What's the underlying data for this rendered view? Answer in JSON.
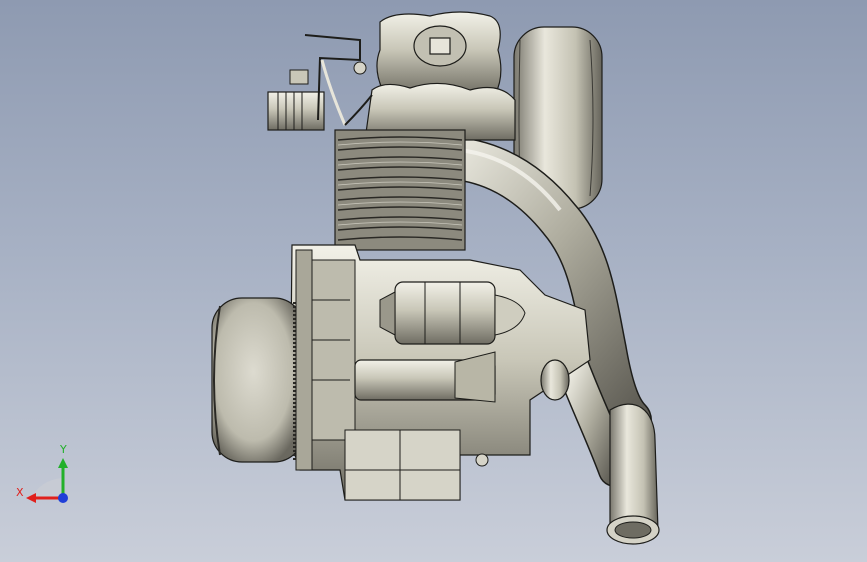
{
  "viewport": {
    "background_top": "#8e9ab1",
    "background_bottom": "#c9ced9",
    "model": "engine-assembly",
    "view_orientation": "left"
  },
  "triad": {
    "x_label": "X",
    "y_label": "Y",
    "x_color": "#e0201c",
    "y_color": "#22b02a",
    "z_color": "#1f3fd8"
  },
  "colors": {
    "metal_light": "#e6e4d8",
    "metal_mid": "#b8b6a6",
    "metal_dark": "#6e6c62",
    "edge": "#1d1d1a"
  }
}
